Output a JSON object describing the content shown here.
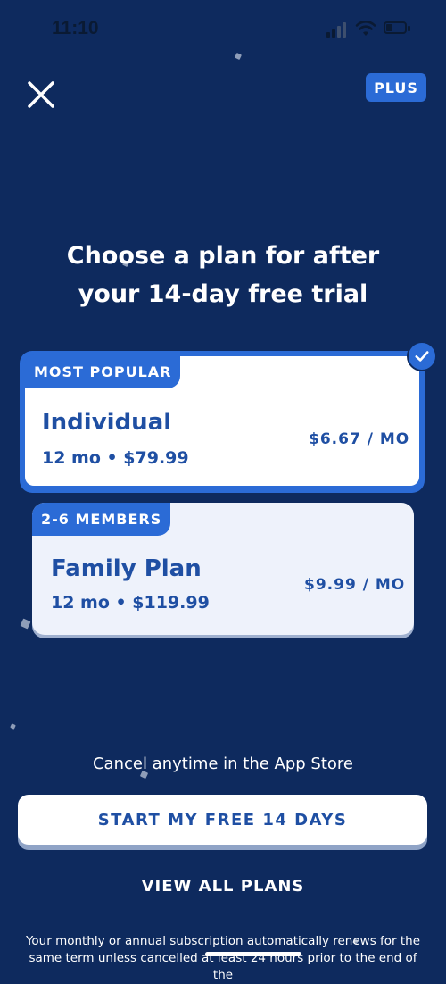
{
  "status_bar": {
    "time": "11:10"
  },
  "header": {
    "badge": "PLUS"
  },
  "headline": {
    "line1": "Choose a plan for after",
    "line2": "your 14-day free trial"
  },
  "plans": [
    {
      "ribbon": "MOST POPULAR",
      "name": "Individual",
      "term": "12 mo • $79.99",
      "price": "$6.67 / MO",
      "selected": true
    },
    {
      "ribbon": "2-6 MEMBERS",
      "name": "Family Plan",
      "term": "12 mo • $119.99",
      "price": "$9.99 / MO",
      "selected": false
    }
  ],
  "cancel_note": "Cancel anytime in the App Store",
  "cta_label": "START MY FREE 14 DAYS",
  "view_all_label": "VIEW ALL PLANS",
  "legal": {
    "line1": "Your monthly or annual subscription automatically renews for the",
    "line2": "same term unless cancelled at least 24 hours prior to the end of the"
  },
  "colors": {
    "background": "#0e2a5e",
    "accent": "#2b6bd6",
    "text_blue": "#1f4fa3"
  },
  "icons": {
    "close": "close-icon",
    "selected": "checkmark-icon"
  }
}
